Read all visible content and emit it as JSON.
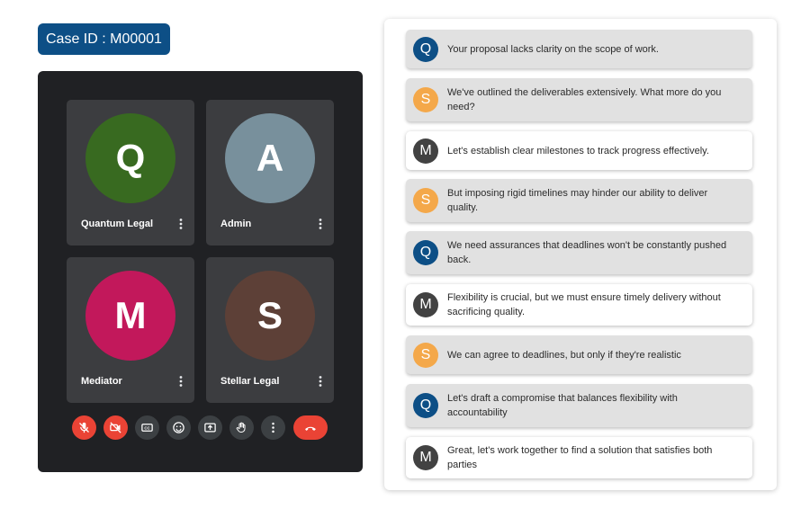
{
  "case": {
    "label": "Case ID : M00001"
  },
  "participants": [
    {
      "initial": "Q",
      "name": "Quantum Legal",
      "color": "#386a20"
    },
    {
      "initial": "A",
      "name": "Admin",
      "color": "#78909c"
    },
    {
      "initial": "M",
      "name": "Mediator",
      "color": "#c2185b"
    },
    {
      "initial": "S",
      "name": "Stellar Legal",
      "color": "#5d4037"
    }
  ],
  "controls": [
    {
      "icon": "microphone-off-icon",
      "state": "off",
      "color": "#ea4335"
    },
    {
      "icon": "camera-off-icon",
      "state": "off",
      "color": "#ea4335"
    },
    {
      "icon": "closed-captions-icon",
      "color": "#3c4043"
    },
    {
      "icon": "emoji-icon",
      "color": "#3c4043"
    },
    {
      "icon": "present-screen-icon",
      "color": "#3c4043"
    },
    {
      "icon": "raise-hand-icon",
      "color": "#3c4043"
    },
    {
      "icon": "more-options-icon",
      "color": "#3c4043"
    },
    {
      "icon": "end-call-icon",
      "color": "#ea4335"
    }
  ],
  "colors": {
    "Q": "#0d4f86",
    "S": "#f4a84a",
    "M": "#424242"
  },
  "chat": [
    {
      "initial": "Q",
      "text": "Your proposal lacks clarity on the scope of work."
    },
    {
      "initial": "S",
      "text": "We've outlined the deliverables extensively. What more do you need?"
    },
    {
      "initial": "M",
      "text": "Let's establish clear milestones to track progress effectively."
    },
    {
      "initial": "S",
      "text": "But imposing rigid timelines may hinder our ability to deliver quality."
    },
    {
      "initial": "Q",
      "text": "We need assurances that deadlines won't be constantly pushed back."
    },
    {
      "initial": "M",
      "text": "Flexibility is crucial, but we must ensure timely delivery without sacrificing quality."
    },
    {
      "initial": "S",
      "text": "We can agree to deadlines, but only if they're realistic"
    },
    {
      "initial": "Q",
      "text": "Let's draft a compromise that balances flexibility with accountability"
    },
    {
      "initial": "M",
      "text": "Great, let's work together to find a solution that satisfies both parties"
    }
  ]
}
